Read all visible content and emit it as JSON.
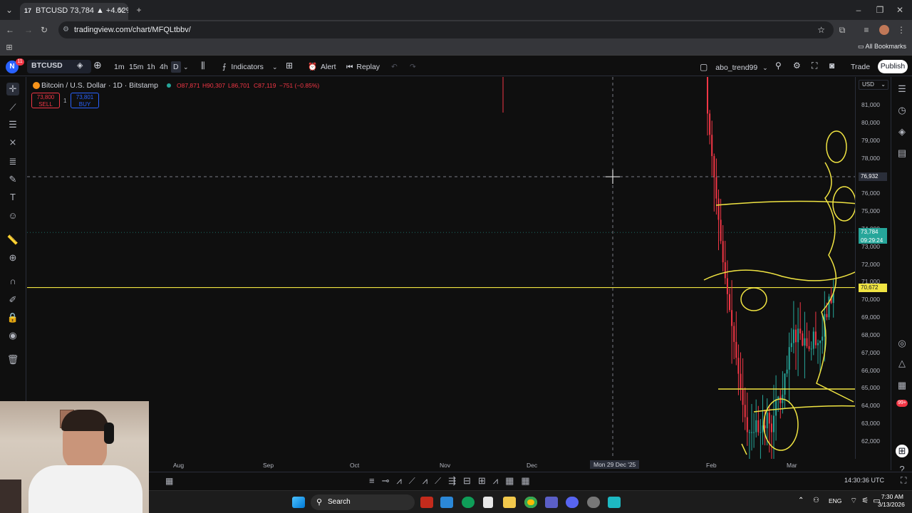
{
  "browser": {
    "tab_title": "BTCUSD 73,784 ▲ +4.62% abo...",
    "url": "tradingview.com/chart/MFQLtbbv/",
    "bookmarks_label": "All Bookmarks"
  },
  "toolbar": {
    "avatar_letter": "N",
    "notif_count": "11",
    "symbol": "BTCUSD",
    "intervals": [
      "1m",
      "15m",
      "1h",
      "4h",
      "D"
    ],
    "indicators": "Indicators",
    "alert": "Alert",
    "replay": "Replay",
    "layout_name": "abo_trend99",
    "trade": "Trade",
    "publish": "Publish"
  },
  "legend": {
    "title": "Bitcoin / U.S. Dollar · 1D · Bitstamp",
    "open": "O87,871",
    "high": "H90,307",
    "low": "L86,701",
    "close": "C87,119",
    "change": "−751 (−0.85%)",
    "sell_price": "73,800",
    "sell_label": "SELL",
    "spread": "1",
    "buy_price": "73,801",
    "buy_label": "BUY"
  },
  "chart_data": {
    "type": "candlestick",
    "symbol": "BTCUSD",
    "currency": "USD",
    "y_ticks": [
      "81,000",
      "80,000",
      "79,000",
      "78,000",
      "76,000",
      "75,000",
      "74,000",
      "73,000",
      "72,000",
      "71,000",
      "70,000",
      "69,000",
      "68,000",
      "67,000",
      "66,000",
      "65,000",
      "64,000",
      "63,000",
      "62,000"
    ],
    "x_ticks": [
      "Aug",
      "Sep",
      "Oct",
      "Nov",
      "Dec",
      "Feb",
      "Mar"
    ],
    "crosshair_price": "76,932",
    "crosshair_date": "Mon 29 Dec '25",
    "last_price": "73,784",
    "countdown": "09:29:24",
    "hline_price": "70,672",
    "ylim": [
      61500,
      81700
    ]
  },
  "bottom": {
    "time_utc": "14:30:36 UTC"
  },
  "taskbar": {
    "search": "Search",
    "lang": "ENG",
    "time": "7:30 AM",
    "date": "3/13/2026",
    "badge": "99+"
  },
  "colors": {
    "up": "#26a69a",
    "down": "#f23645",
    "yellow": "#f0e442",
    "accent": "#2962ff"
  }
}
